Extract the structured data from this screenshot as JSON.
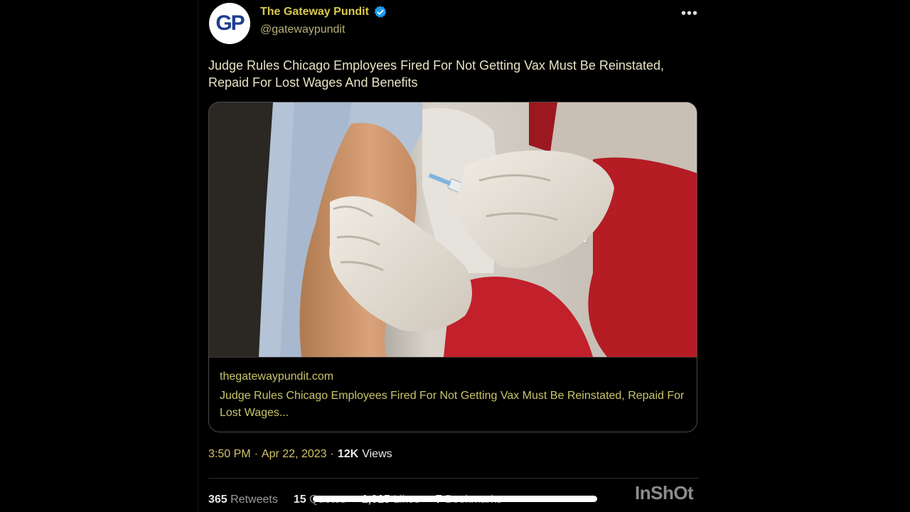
{
  "author": {
    "avatar_text": "GP",
    "display_name": "The Gateway Pundit",
    "handle": "@gatewaypundit",
    "verified_icon": "verified-badge-icon"
  },
  "more_icon": "more-options-icon",
  "tweet": {
    "text": "Judge Rules Chicago Employees Fired For Not Getting Vax Must Be Reinstated, Repaid For Lost Wages And Benefits"
  },
  "card": {
    "domain": "thegatewaypundit.com",
    "title": "Judge Rules Chicago Employees Fired For Not Getting Vax Must Be Reinstated, Repaid For Lost Wages..."
  },
  "meta": {
    "time": "3:50 PM",
    "separator": "·",
    "date": "Apr 22, 2023",
    "separator2": "·",
    "views_count": "12K",
    "views_label": "Views"
  },
  "stats": {
    "retweets_count": "365",
    "retweets_label": "Retweets",
    "quotes_count": "15",
    "quotes_label": "Quotes",
    "likes_count": "1,015",
    "likes_label": "Likes",
    "bookmarks_count": "7",
    "bookmarks_label": "Bookmarks"
  },
  "watermark": "InShOt",
  "colors": {
    "background": "#000000",
    "name_yellow": "#d9c94a",
    "verified_blue": "#1d9bf0",
    "avatar_blue": "#1d3f8f",
    "glove_red": "#b51c24"
  }
}
